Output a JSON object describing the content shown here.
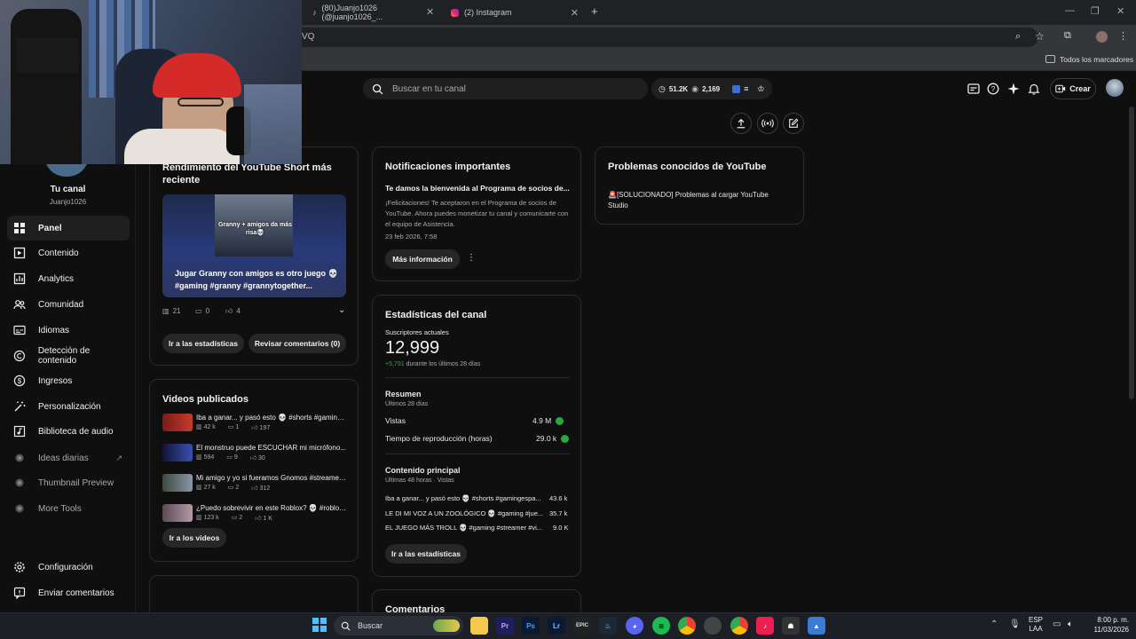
{
  "browser": {
    "tabs": [
      {
        "label": "(80)Juanjo1026 (@juanjo1026_..."
      },
      {
        "label": "(2) Instagram"
      }
    ],
    "url_fragment": "VQ",
    "bookmarks_label": "Todos los marcadores"
  },
  "channel": {
    "name": "Tu canal",
    "handle": "Juanjo1026"
  },
  "sidebar": {
    "items": [
      {
        "label": "Panel",
        "icon": "dashboard-icon"
      },
      {
        "label": "Contenido",
        "icon": "content-icon"
      },
      {
        "label": "Analytics",
        "icon": "analytics-icon"
      },
      {
        "label": "Comunidad",
        "icon": "community-icon"
      },
      {
        "label": "Idiomas",
        "icon": "subtitles-icon"
      },
      {
        "label": "Detección de contenido",
        "icon": "copyright-icon"
      },
      {
        "label": "Ingresos",
        "icon": "dollar-icon"
      },
      {
        "label": "Personalización",
        "icon": "wand-icon"
      },
      {
        "label": "Biblioteca de audio",
        "icon": "audio-library-icon"
      },
      {
        "label": "Ideas diarias",
        "icon": "extension-icon"
      },
      {
        "label": "Thumbnail Preview",
        "icon": "extension-icon"
      },
      {
        "label": "More Tools",
        "icon": "extension-icon"
      }
    ],
    "footer": [
      {
        "label": "Configuración",
        "icon": "gear-icon"
      },
      {
        "label": "Enviar comentarios",
        "icon": "feedback-icon"
      }
    ]
  },
  "header": {
    "search_placeholder": "Buscar en tu canal",
    "stats_subs": "51.2K",
    "stats_views": "2,169",
    "create_label": "Crear"
  },
  "short_card": {
    "title": "Rendimiento del YouTube Short más reciente",
    "overlay_caption": "Granny + amigos da más risa💀",
    "video_title": "Jugar Granny con amigos es otro juego 💀 #gaming #granny #grannytogether...",
    "views": "21",
    "comments": "0",
    "likes": "4",
    "btn_stats": "Ir a las estadísticas",
    "btn_comments": "Revisar comentarios (0)"
  },
  "published": {
    "title": "Videos publicados",
    "videos": [
      {
        "title": "Iba a ganar... y pasó esto 💀 #shorts #gaminge...",
        "views": "42 k",
        "comments": "1",
        "likes": "197"
      },
      {
        "title": "El monstruo puede ESCUCHAR mi micrófono... ",
        "views": "594",
        "comments": "9",
        "likes": "30"
      },
      {
        "title": "Mi amigo y yo si fueramos Gnomos #streamer ...",
        "views": "27 k",
        "comments": "2",
        "likes": "312"
      },
      {
        "title": "¿Puedo sobrevivir en este Roblox? 💀 #roblox ...",
        "views": "123 k",
        "comments": "2",
        "likes": "1 K"
      }
    ],
    "btn": "Ir a los videos"
  },
  "notifications": {
    "title": "Notificaciones importantes",
    "headline": "Te damos la bienvenida al Programa de socios de...",
    "body": "¡Felicitaciones! Te aceptaron en el Programa de socios de YouTube. Ahora puedes monetizar tu canal y comunicarte con el equipo de Asistencia.",
    "date": "23 feb 2026, 7:58",
    "btn": "Más información"
  },
  "stats": {
    "title": "Estadísticas del canal",
    "subs_label": "Suscriptores actuales",
    "subs_value": "12,999",
    "subs_delta": "+5,791",
    "subs_period": "durante los últimos 28 días",
    "summary_title": "Resumen",
    "summary_period": "Últimos 28 días",
    "views_label": "Vistas",
    "views_value": "4.9 M",
    "watch_label": "Tiempo de reproducción (horas)",
    "watch_value": "29.0 k",
    "top_title": "Contenido principal",
    "top_period": "Últimas 48 horas · Vistas",
    "top": [
      {
        "title": "Iba a ganar... y pasó esto 💀 #shorts #gamingespa...",
        "value": "43.6 k"
      },
      {
        "title": "LE DI MI VOZ A UN ZOOLÓGICO 💀 #gaming #jue...",
        "value": "35.7 k"
      },
      {
        "title": "EL JUEGO MÁS TROLL 💀 #gaming #streamer #vi...",
        "value": "9.0 K"
      }
    ],
    "btn": "Ir a las estadísticas"
  },
  "comments_card": {
    "title": "Comentarios"
  },
  "issues": {
    "title": "Problemas conocidos de YouTube",
    "item": "🚨[SOLUCIONADO] Problemas al cargar YouTube Studio"
  },
  "taskbar": {
    "search": "Buscar",
    "lang": "ESP",
    "lang2": "LAA",
    "time": "8:00 p. m.",
    "date": "11/03/2026"
  },
  "colors": {
    "accent_green": "#2ba640",
    "bg": "#0f0f0f",
    "card_border": "#2a2a2a"
  }
}
